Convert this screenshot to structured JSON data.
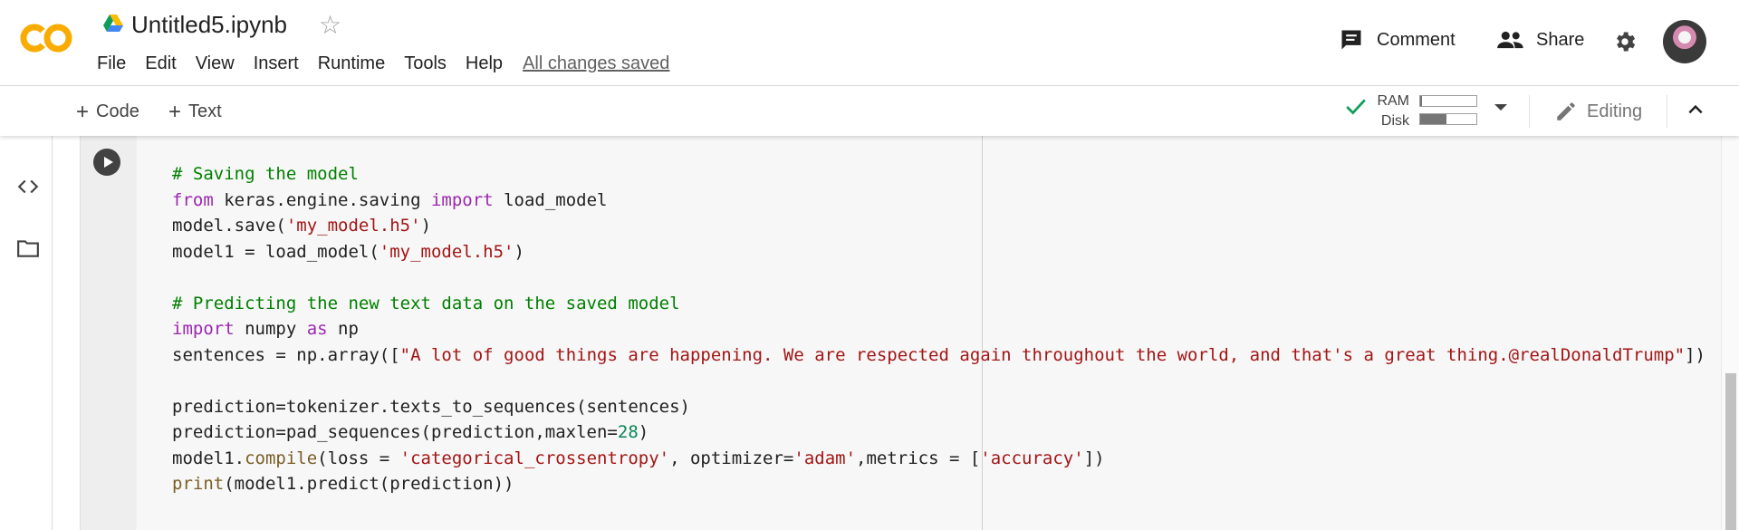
{
  "header": {
    "title": "Untitled5.ipynb",
    "menu": [
      "File",
      "Edit",
      "View",
      "Insert",
      "Runtime",
      "Tools",
      "Help"
    ],
    "save_status": "All changes saved",
    "comment_label": "Comment",
    "share_label": "Share"
  },
  "toolbar": {
    "add_code_label": "Code",
    "add_text_label": "Text",
    "ram_label": "RAM",
    "disk_label": "Disk",
    "ram_usage": 0.04,
    "disk_usage": 0.46,
    "editing_label": "Editing"
  },
  "colors": {
    "logo_orange": "#f9ab00",
    "comment": "#008000",
    "keyword": "#9c27b0",
    "string": "#a31515",
    "number": "#098658",
    "check": "#0f9d58"
  },
  "cell": {
    "code_lines": [
      [
        [
          "cm",
          "# Saving the model"
        ]
      ],
      [
        [
          "kw",
          "from"
        ],
        [
          "",
          " keras.engine.saving "
        ],
        [
          "kw",
          "import"
        ],
        [
          "",
          " load_model"
        ]
      ],
      [
        [
          "",
          "model.save("
        ],
        [
          "st",
          "'my_model.h5'"
        ],
        [
          "",
          ")"
        ]
      ],
      [
        [
          "",
          "model1 = load_model("
        ],
        [
          "st",
          "'my_model.h5'"
        ],
        [
          "",
          ")"
        ]
      ],
      [
        [
          "",
          ""
        ]
      ],
      [
        [
          "cm",
          "# Predicting the new text data on the saved model"
        ]
      ],
      [
        [
          "kw",
          "import"
        ],
        [
          "",
          " numpy "
        ],
        [
          "kw",
          "as"
        ],
        [
          "",
          " np"
        ]
      ],
      [
        [
          "",
          "sentences = np.array(["
        ],
        [
          "st",
          "\"A lot of good things are happening. We are respected again throughout the world, and that's a great thing.@realDonaldTrump\""
        ],
        [
          "",
          "])"
        ]
      ],
      [
        [
          "",
          ""
        ]
      ],
      [
        [
          "",
          "prediction=tokenizer.texts_to_sequences(sentences)"
        ]
      ],
      [
        [
          "",
          "prediction=pad_sequences(prediction,maxlen="
        ],
        [
          "nm",
          "28"
        ],
        [
          "",
          ")"
        ]
      ],
      [
        [
          "",
          "model1."
        ],
        [
          "bi",
          "compile"
        ],
        [
          "",
          "(loss = "
        ],
        [
          "st",
          "'categorical_crossentropy'"
        ],
        [
          "",
          ", optimizer="
        ],
        [
          "st",
          "'adam'"
        ],
        [
          "",
          ",metrics = ["
        ],
        [
          "st",
          "'accuracy'"
        ],
        [
          "",
          "])"
        ]
      ],
      [
        [
          "bi",
          "print"
        ],
        [
          "",
          "(model1.predict(prediction))"
        ]
      ]
    ]
  }
}
